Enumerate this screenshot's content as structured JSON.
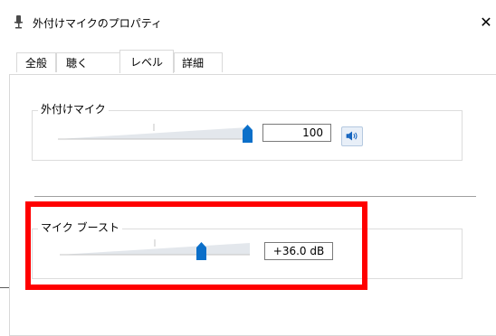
{
  "window": {
    "title": "外付けマイクのプロパティ",
    "close_glyph": "✕"
  },
  "tabs": [
    {
      "label": "全般",
      "active": false
    },
    {
      "label": "聴く",
      "active": false
    },
    {
      "label": "レベル",
      "active": true
    },
    {
      "label": "詳細",
      "active": false
    }
  ],
  "microphone": {
    "label": "外付けマイク",
    "level": 100,
    "value_text": "100",
    "speaker_icon": "speaker-icon"
  },
  "boost": {
    "label": "マイク ブースト",
    "level_fraction": 0.83,
    "value_text": "+36.0 dB"
  },
  "colors": {
    "thumb": "#0b6fc9",
    "highlight": "#ff0000",
    "speaker_icon": "#1565c0"
  }
}
